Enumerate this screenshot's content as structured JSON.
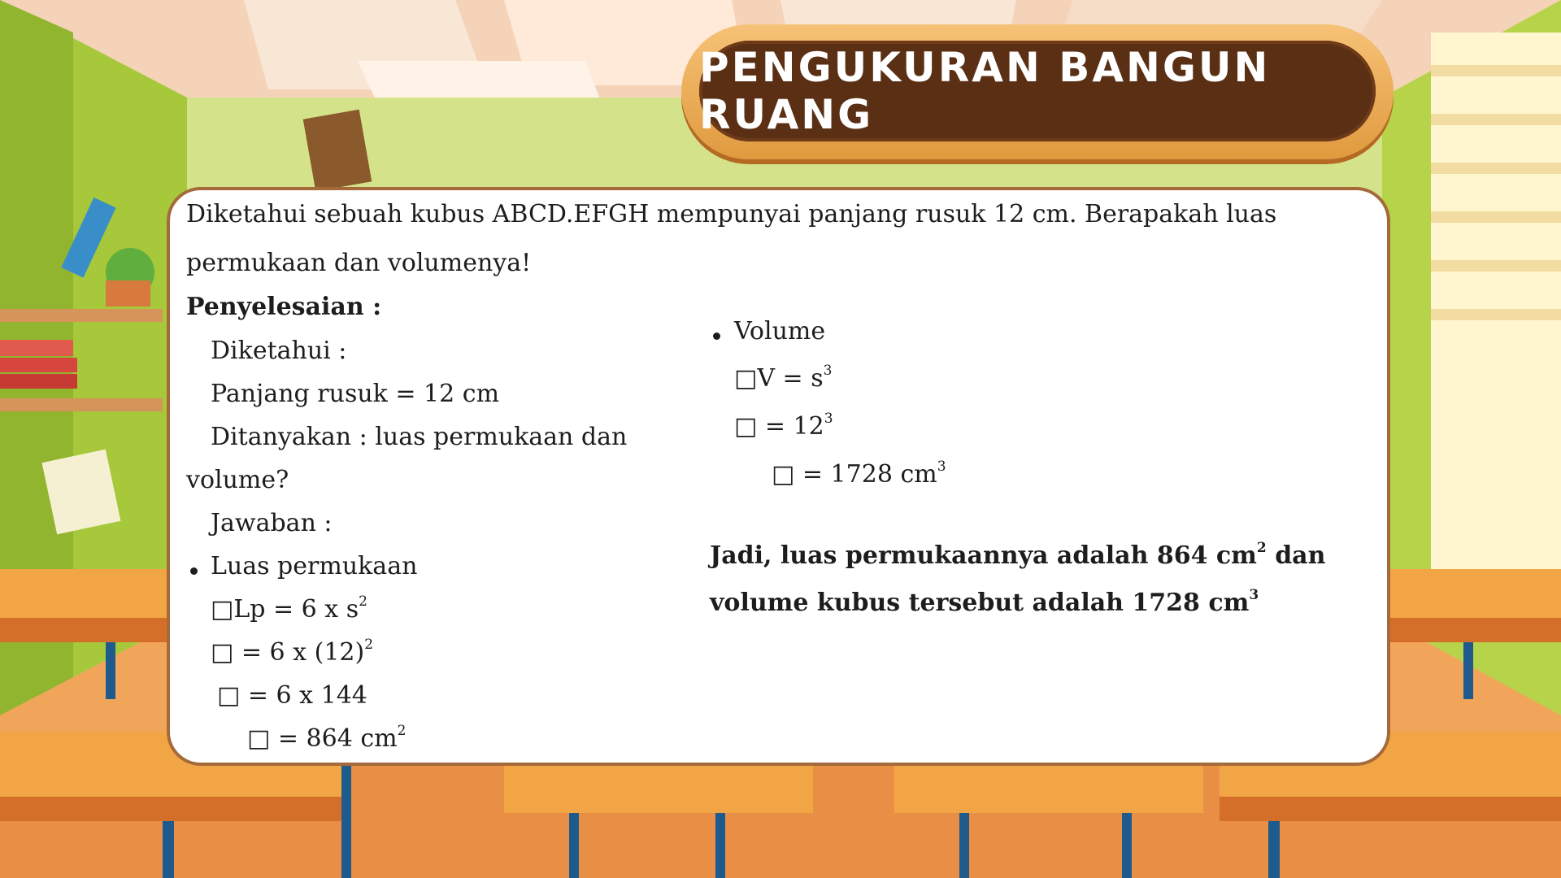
{
  "title": "PENGUKURAN BANGUN RUANG",
  "problem": {
    "line1": "Diketahui sebuah kubus ABCD.EFGH mempunyai panjang rusuk 12 cm. Berapakah luas",
    "line2": "permukaan dan volumenya!"
  },
  "solution": {
    "heading": "Penyelesaian :",
    "known_label": "Diketahui :",
    "edge_length": "Panjang rusuk = 12 cm",
    "asked_line1": "Ditanyakan : luas permukaan dan",
    "asked_line2": "volume?",
    "answer_label": "Jawaban :",
    "surface": {
      "label": "Luas permukaan",
      "step1": "□Lp = 6 x s",
      "step1_sup": "2",
      "step2": "□    = 6 x (12)",
      "step2_sup": "2",
      "step3": "□    = 6 x 144",
      "step4": "□ = 864 cm",
      "step4_sup": "2"
    },
    "volume": {
      "label": "Volume",
      "step1": "□V =  s",
      "step1_sup": "3",
      "step2": "□    = 12",
      "step2_sup": "3",
      "step3": "□ = 1728 cm",
      "step3_sup": "3"
    },
    "conclusion": {
      "line1_a": "Jadi, luas permukaannya adalah 864 cm",
      "line1_sup": "2",
      "line1_b": " dan",
      "line2_a": "volume kubus tersebut adalah 1728 cm",
      "line2_sup": "3"
    }
  }
}
